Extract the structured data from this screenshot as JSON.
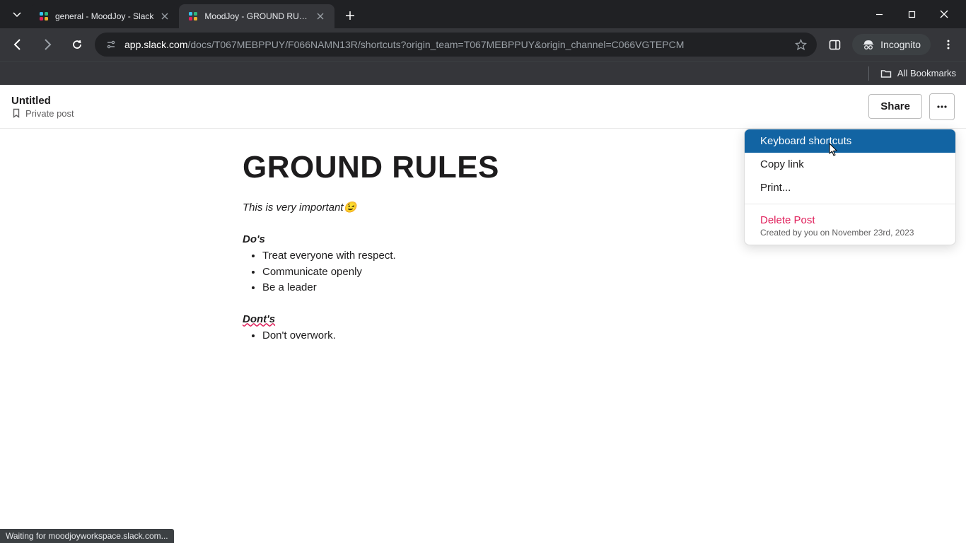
{
  "browser": {
    "tabs": [
      {
        "title": "general - MoodJoy - Slack",
        "active": false
      },
      {
        "title": "MoodJoy - GROUND RULES - S",
        "active": true
      }
    ],
    "url_domain": "app.slack.com",
    "url_path": "/docs/T067MEBPPUY/F066NAMN13R/shortcuts?origin_team=T067MEBPPUY&origin_channel=C066VGTEPCM",
    "incognito_label": "Incognito",
    "bookmarks_label": "All Bookmarks",
    "status_text": "Waiting for moodjoyworkspace.slack.com..."
  },
  "doc": {
    "title": "Untitled",
    "privacy": "Private post",
    "share_label": "Share",
    "heading": "GROUND RULES",
    "intro": "This is very important😉",
    "dos_label": "Do's",
    "dos_items": [
      "Treat everyone with respect.",
      "Communicate openly",
      "Be a leader"
    ],
    "donts_label": "Dont's",
    "donts_items": [
      "Don't overwork."
    ]
  },
  "menu": {
    "keyboard_shortcuts": "Keyboard shortcuts",
    "copy_link": "Copy link",
    "print": "Print...",
    "delete_post": "Delete Post",
    "created_meta": "Created by you on November 23rd, 2023"
  }
}
